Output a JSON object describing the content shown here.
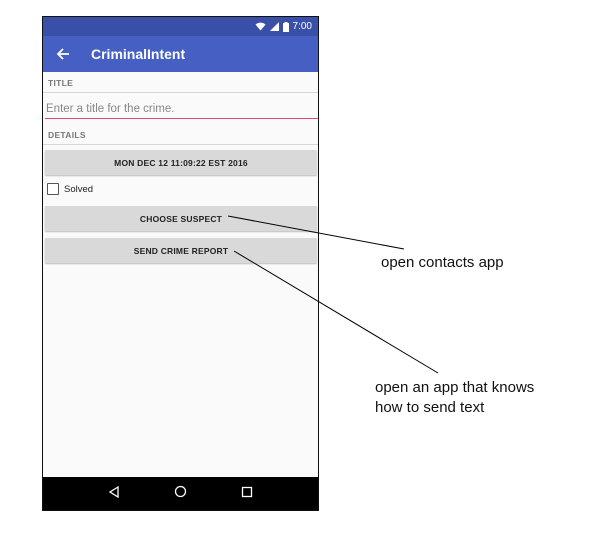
{
  "status_bar": {
    "time": "7:00",
    "icons": [
      "wifi-icon",
      "signal-icon",
      "battery-icon"
    ]
  },
  "app_bar": {
    "title": "CriminalIntent",
    "back_icon": "arrow-back-icon"
  },
  "form": {
    "title_section_label": "TITLE",
    "title_placeholder": "Enter a title for the crime.",
    "title_value": "",
    "details_section_label": "DETAILS",
    "date_button_label": "MON DEC 12 11:09:22 EST 2016",
    "solved_label": "Solved",
    "solved_checked": false,
    "choose_suspect_label": "CHOOSE SUSPECT",
    "send_report_label": "SEND CRIME REPORT"
  },
  "nav_bar": {
    "icons": [
      "back-triangle-icon",
      "home-circle-icon",
      "recents-square-icon"
    ]
  },
  "annotations": {
    "contacts": "open contacts app",
    "send_text_line1": "open an app that knows",
    "send_text_line2": "how to send text"
  },
  "colors": {
    "status_bar": "#3a4fa8",
    "app_bar": "#4560c2",
    "accent": "#e0457b",
    "button": "#d9d9d9"
  }
}
